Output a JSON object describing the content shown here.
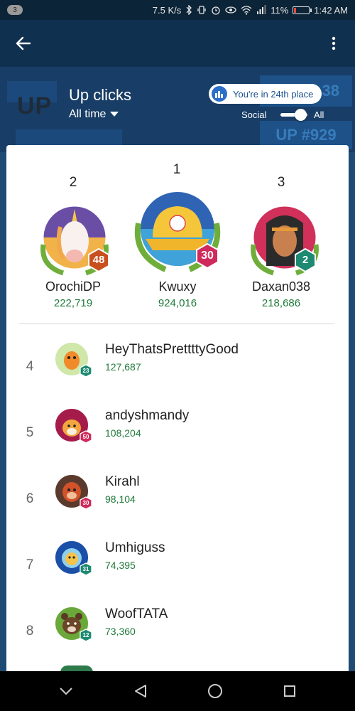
{
  "status_bar": {
    "notification_count": "3",
    "network_speed": "7.5 K/s",
    "battery": "11%",
    "time": "1:42 AM"
  },
  "app_bar": {
    "back_icon": "arrow-left-icon",
    "menu_icon": "more-vertical-icon"
  },
  "header": {
    "logo_text": "UP",
    "title": "Up clicks",
    "filter_label": "All time",
    "place_chip": "You're in 24th place",
    "toggle_left": "Social",
    "toggle_right": "All",
    "toggle_state": "All",
    "background_pills": [
      "38",
      "UP #929"
    ]
  },
  "podium": [
    {
      "rank": "2",
      "name": "OrochiDP",
      "score": "222,719",
      "level": "48",
      "badge_color": "#c8501e"
    },
    {
      "rank": "1",
      "name": "Kwuxy",
      "score": "924,016",
      "level": "30",
      "badge_color": "#d02a5c"
    },
    {
      "rank": "3",
      "name": "Daxan038",
      "score": "218,686",
      "level": "2",
      "badge_color": "#1e8a72"
    }
  ],
  "list": [
    {
      "rank": "4",
      "name": "HeyThatsPrettttyGood",
      "score": "127,687",
      "level": "23",
      "badge_color": "#1e8a72"
    },
    {
      "rank": "5",
      "name": "andyshmandy",
      "score": "108,204",
      "level": "50",
      "badge_color": "#d02a5c"
    },
    {
      "rank": "6",
      "name": "Kirahl",
      "score": "98,104",
      "level": "30",
      "badge_color": "#d02a5c"
    },
    {
      "rank": "7",
      "name": "Umhiguss",
      "score": "74,395",
      "level": "31",
      "badge_color": "#1e8a72"
    },
    {
      "rank": "8",
      "name": "WoofTATA",
      "score": "73,360",
      "level": "12",
      "badge_color": "#1e8a72"
    }
  ],
  "nav": {
    "down_icon": "chevron-down-icon",
    "back_icon": "triangle-back-icon",
    "home_icon": "circle-home-icon",
    "recents_icon": "square-recents-icon"
  },
  "colors": {
    "score_green": "#1f7a3a",
    "header_blue": "#183d66",
    "appbar_blue": "#10304f"
  }
}
